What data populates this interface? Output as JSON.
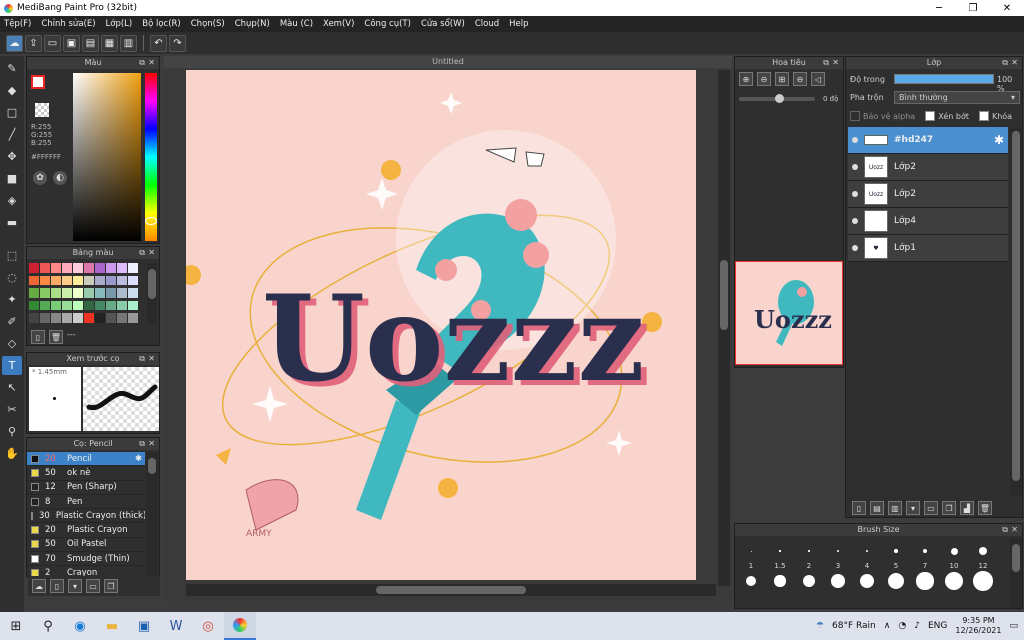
{
  "window": {
    "title": "MediBang Paint Pro (32bit)",
    "minimize": "─",
    "maximize": "❐",
    "close": "✕"
  },
  "menu": [
    "Tệp(F)",
    "Chỉnh sửa(E)",
    "Lớp(L)",
    "Bộ lọc(R)",
    "Chọn(S)",
    "Chụp(N)",
    "Màu (C)",
    "Xem(V)",
    "Công cụ(T)",
    "Cửa sổ(W)",
    "Cloud",
    "Help"
  ],
  "color_panel": {
    "title": "Màu",
    "r": "R:255",
    "g": "G:255",
    "b": "B:255",
    "hex": "#FFFFFF"
  },
  "palette_panel": {
    "title": "Bảng màu",
    "more": "---"
  },
  "preview_panel": {
    "title": "Xem trước cọ",
    "size": "1.45mm"
  },
  "brush_panel": {
    "title": "Cọ: Pencil",
    "items": [
      {
        "size": "20",
        "name": "Pencil",
        "color": "#111111",
        "selected": true
      },
      {
        "size": "50",
        "name": "ok nè",
        "color": "#e8d84a",
        "selected": false
      },
      {
        "size": "12",
        "name": "Pen (Sharp)",
        "color": "#222222",
        "selected": false
      },
      {
        "size": "8",
        "name": "Pen",
        "color": "#222222",
        "selected": false
      },
      {
        "size": "30",
        "name": "Plastic Crayon (thick)",
        "color": "#e8d84a",
        "selected": false
      },
      {
        "size": "20",
        "name": "Plastic Crayon",
        "color": "#e8d84a",
        "selected": false
      },
      {
        "size": "50",
        "name": "Oil Pastel",
        "color": "#e8d84a",
        "selected": false
      },
      {
        "size": "70",
        "name": "Smudge (Thin)",
        "color": "#ffffff",
        "selected": false
      },
      {
        "size": "2",
        "name": "Crayon",
        "color": "#e8d84a",
        "selected": false
      }
    ]
  },
  "canvas": {
    "tab": "Untitled"
  },
  "navigator": {
    "title": "Hoa tiêu",
    "angle": "0 độ"
  },
  "layers": {
    "title": "Lớp",
    "opacity_label": "Độ trong",
    "opacity_value": "100 %",
    "blend_label": "Pha trộn",
    "blend_value": "Bình thường",
    "protect_alpha": "Bảo vệ alpha",
    "clipping": "Xén bớt",
    "lock": "Khóa",
    "items": [
      {
        "name": "#hd247",
        "thumb": "",
        "selected": true
      },
      {
        "name": "Lớp2",
        "thumb": "Uozz",
        "selected": false
      },
      {
        "name": "Lớp2",
        "thumb": "Uozz",
        "selected": false
      },
      {
        "name": "Lớp4",
        "thumb": "",
        "selected": false
      },
      {
        "name": "Lớp1",
        "thumb": "♥",
        "selected": false
      }
    ]
  },
  "brush_size": {
    "title": "Brush Size",
    "labels": [
      "1",
      "1.5",
      "2",
      "3",
      "4",
      "5",
      "7",
      "10",
      "12"
    ]
  },
  "taskbar": {
    "weather": "68°F  Rain",
    "lang": "ENG",
    "time": "9:35 PM",
    "date": "12/26/2021"
  },
  "artwork": {
    "title_text": "Uozzz",
    "small_text": "ARMY"
  }
}
